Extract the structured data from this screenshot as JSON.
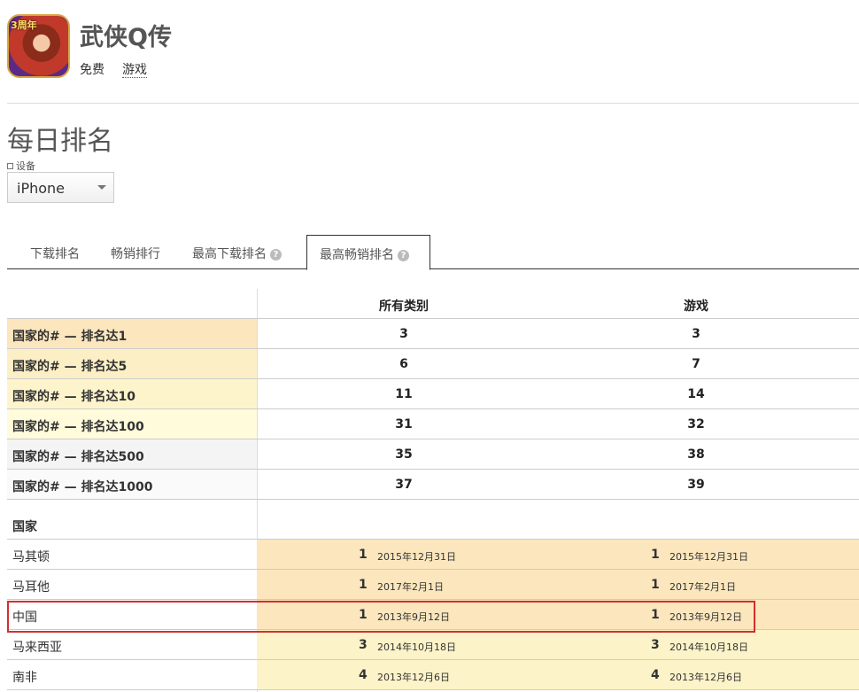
{
  "app": {
    "name": "武侠Q传",
    "price": "免费",
    "category": "游戏",
    "icon_badge": "3周年"
  },
  "section_title": "每日排名",
  "device": {
    "label": "设备",
    "selected": "iPhone"
  },
  "tabs": [
    {
      "label": "下载排名",
      "help": false
    },
    {
      "label": "畅销排行",
      "help": false
    },
    {
      "label": "最高下载排名",
      "help": true
    },
    {
      "label": "最高畅销排名",
      "help": true,
      "active": true
    }
  ],
  "table": {
    "columns": [
      "所有类别",
      "游戏"
    ],
    "summary": [
      {
        "label": "国家的# — 排名达1",
        "values": [
          "3",
          "3"
        ],
        "color": "#fbe6bd"
      },
      {
        "label": "国家的# — 排名达5",
        "values": [
          "6",
          "7"
        ],
        "color": "#fdefc5"
      },
      {
        "label": "国家的# — 排名达10",
        "values": [
          "11",
          "14"
        ],
        "color": "#fef4cc"
      },
      {
        "label": "国家的# — 排名达100",
        "values": [
          "31",
          "32"
        ],
        "color": "#fffbdb"
      },
      {
        "label": "国家的# — 排名达500",
        "values": [
          "35",
          "38"
        ],
        "color": "#f4f4f4"
      },
      {
        "label": "国家的# — 排名达1000",
        "values": [
          "37",
          "39"
        ],
        "color": "#fafafa"
      }
    ],
    "country_header": "国家",
    "countries": [
      {
        "name": "马其顿",
        "all": {
          "rank": "1",
          "date": "2015年12月31日"
        },
        "games": {
          "rank": "1",
          "date": "2015年12月31日"
        },
        "color": "#fbe6bd"
      },
      {
        "name": "马耳他",
        "all": {
          "rank": "1",
          "date": "2017年2月1日"
        },
        "games": {
          "rank": "1",
          "date": "2017年2月1日"
        },
        "color": "#fbe6bd"
      },
      {
        "name": "中国",
        "all": {
          "rank": "1",
          "date": "2013年9月12日"
        },
        "games": {
          "rank": "1",
          "date": "2013年9月12日"
        },
        "color": "#fbe6bd",
        "highlighted": true
      },
      {
        "name": "马来西亚",
        "all": {
          "rank": "3",
          "date": "2014年10月18日"
        },
        "games": {
          "rank": "3",
          "date": "2014年10月18日"
        },
        "color": "#fdf3c8"
      },
      {
        "name": "南非",
        "all": {
          "rank": "4",
          "date": "2013年12月6日"
        },
        "games": {
          "rank": "4",
          "date": "2013年12月6日"
        },
        "color": "#fdf3c8"
      }
    ]
  },
  "highlight_color": "#d03030"
}
